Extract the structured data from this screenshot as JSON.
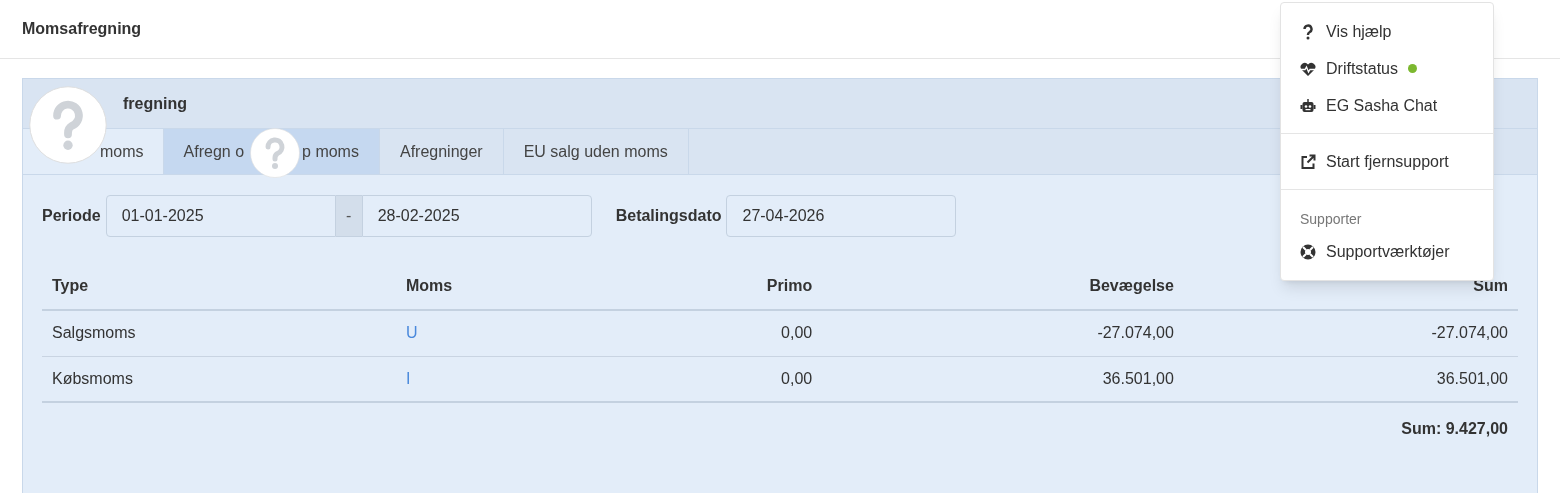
{
  "page_title": "Momsafregning",
  "panel": {
    "title_visible": "fregning"
  },
  "tabs": [
    {
      "parts": [
        "moms"
      ],
      "selected": true,
      "highlighted": false
    },
    {
      "parts": [
        "Afregn o",
        "p moms"
      ],
      "selected": false,
      "highlighted": true
    },
    {
      "parts": [
        "Afregninger"
      ],
      "selected": false,
      "highlighted": false
    },
    {
      "parts": [
        "EU salg uden moms"
      ],
      "selected": false,
      "highlighted": false
    }
  ],
  "form": {
    "period_label": "Periode",
    "from": "01-01-2025",
    "separator": "-",
    "to": "28-02-2025",
    "payment_label": "Betalingsdato",
    "payment_date": "27-04-2026"
  },
  "table": {
    "columns": [
      {
        "label": "Type"
      },
      {
        "label": "Moms"
      },
      {
        "label": "Primo"
      },
      {
        "label": "Bevægelse"
      },
      {
        "label": "Sum"
      }
    ],
    "rows": [
      [
        "Salgsmoms",
        "U",
        "0,00",
        "-27.074,00",
        "-27.074,00"
      ],
      [
        "Købsmoms",
        "I",
        "0,00",
        "36.501,00",
        "36.501,00"
      ]
    ],
    "total": "Sum: 9.427,00"
  },
  "menu": {
    "items": [
      {
        "kind": "item",
        "label": "Vis hjælp"
      },
      {
        "kind": "item",
        "label": "Driftstatus",
        "color": "#7cb82f"
      },
      {
        "kind": "item",
        "label": "EG Sasha Chat"
      },
      {
        "kind": "divider"
      },
      {
        "kind": "item",
        "label": "Start fjernsupport"
      },
      {
        "kind": "divider"
      },
      {
        "kind": "header",
        "label": "Supporter"
      },
      {
        "kind": "item",
        "label": "Supportværktøjer"
      }
    ]
  }
}
